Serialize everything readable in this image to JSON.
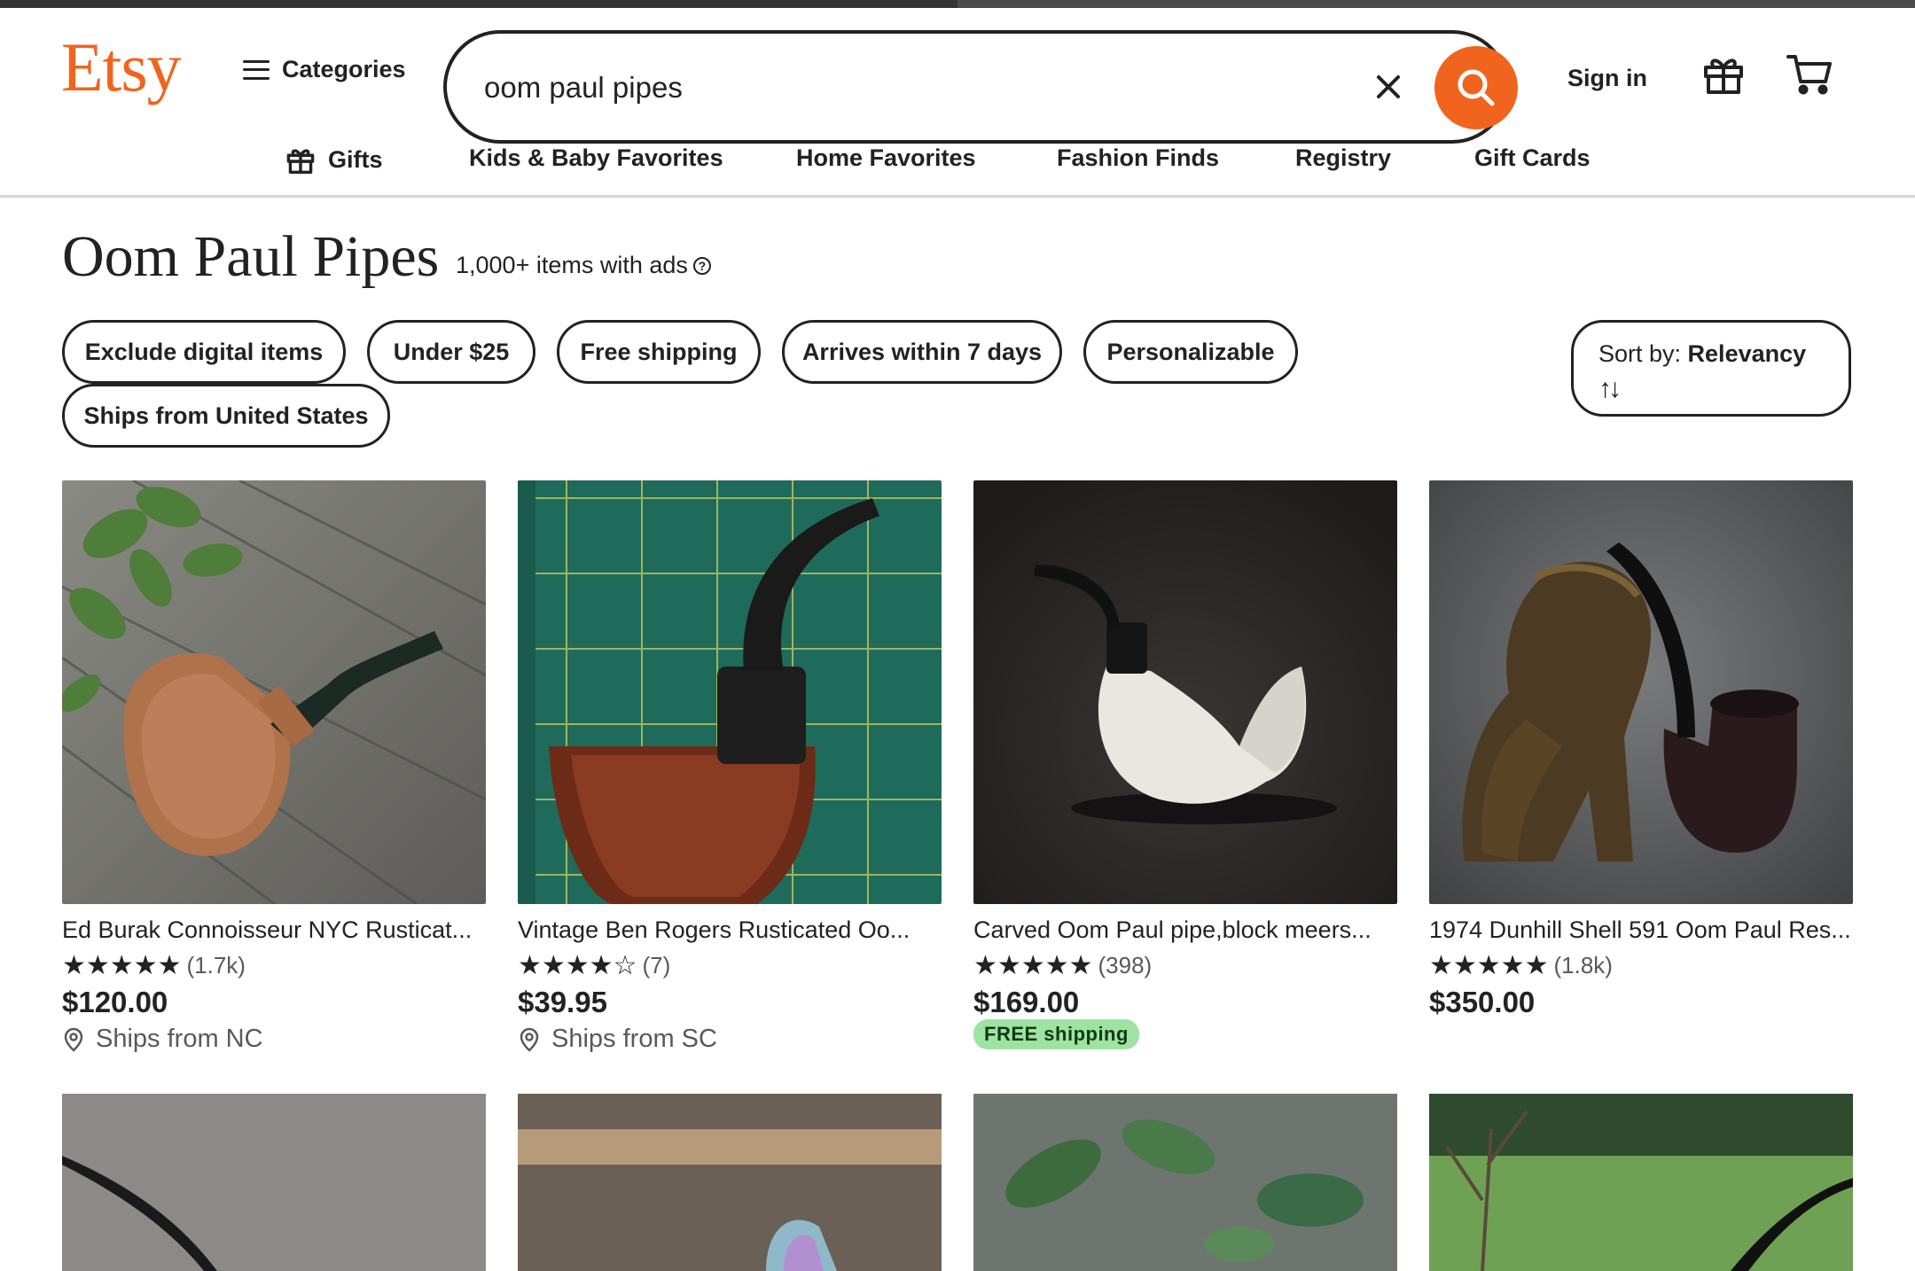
{
  "header": {
    "logo": "Etsy",
    "categories_label": "Categories",
    "search": {
      "value": "oom paul pipes"
    },
    "sign_in": "Sign in"
  },
  "nav": {
    "items": [
      {
        "label": "Gifts"
      },
      {
        "label": "Kids & Baby Favorites"
      },
      {
        "label": "Home Favorites"
      },
      {
        "label": "Fashion Finds"
      },
      {
        "label": "Registry"
      },
      {
        "label": "Gift Cards"
      }
    ]
  },
  "results": {
    "title": "Oom Paul Pipes",
    "count": "1,000+ items with ads"
  },
  "filters": [
    "Exclude digital items",
    "Under $25",
    "Free shipping",
    "Arrives within 7 days",
    "Personalizable",
    "Ships from United States"
  ],
  "sort": {
    "prefix": "Sort by: ",
    "value": "Relevancy",
    "arrows": "↑↓"
  },
  "listings": [
    {
      "title": "Ed Burak Connoisseur NYC Rusticat...",
      "rating": 5,
      "reviews": "(1.7k)",
      "price": "$120.00",
      "ships": "Ships from NC"
    },
    {
      "title": "Vintage Ben Rogers Rusticated Oo...",
      "rating": 4.5,
      "reviews": "(7)",
      "price": "$39.95",
      "ships": "Ships from SC"
    },
    {
      "title": "Carved Oom Paul pipe,block meers...",
      "rating": 5,
      "reviews": "(398)",
      "price": "$169.00",
      "badge": "FREE shipping"
    },
    {
      "title": "1974 Dunhill Shell 591 Oom Paul Res...",
      "rating": 5,
      "reviews": "(1.8k)",
      "price": "$350.00"
    }
  ],
  "icons": {
    "search": "search-icon",
    "clear": "close-icon",
    "gift": "gift-icon",
    "cart": "cart-icon",
    "location": "location-pin-icon",
    "help": "help-icon"
  },
  "colors": {
    "brand": "#f1641e",
    "free_badge": "#9fe3a2"
  }
}
